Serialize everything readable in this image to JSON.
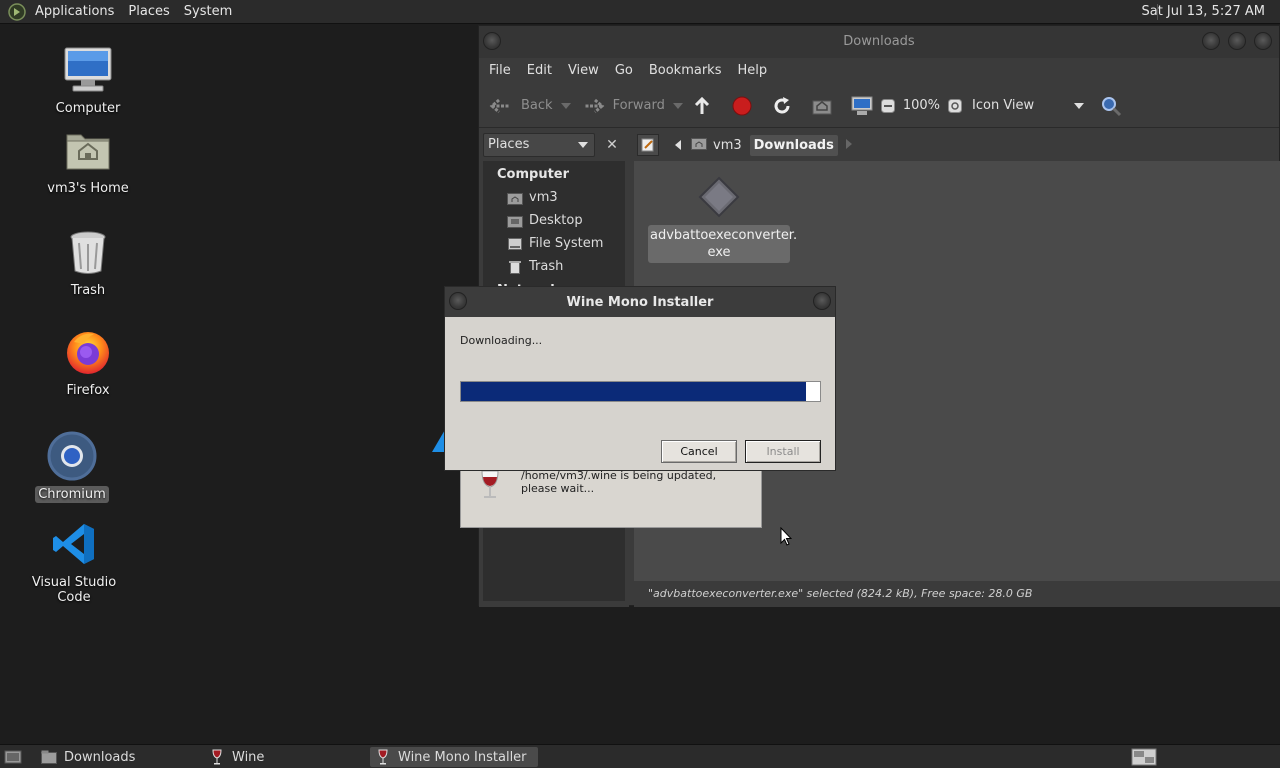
{
  "top_panel": {
    "menus": [
      "Applications",
      "Places",
      "System"
    ],
    "clock": "Sat Jul 13,  5:27 AM"
  },
  "desktop": {
    "icons": [
      {
        "label": "Computer",
        "icon": "computer-icon"
      },
      {
        "label": "vm3's Home",
        "icon": "home-folder-icon"
      },
      {
        "label": "Trash",
        "icon": "trash-icon"
      },
      {
        "label": "Firefox",
        "icon": "firefox-icon"
      },
      {
        "label": "Chromium",
        "icon": "chromium-icon",
        "selected": true
      },
      {
        "label": "Visual Studio Code",
        "icon": "vscode-icon"
      }
    ]
  },
  "file_manager": {
    "title": "Downloads",
    "menus": [
      "File",
      "Edit",
      "View",
      "Go",
      "Bookmarks",
      "Help"
    ],
    "toolbar": {
      "back": "Back",
      "forward": "Forward",
      "zoom": "100%",
      "view_mode": "Icon View"
    },
    "sidebar": {
      "selector": "Places",
      "section": "Computer",
      "items": [
        "vm3",
        "Desktop",
        "File System",
        "Trash"
      ],
      "partial_section": "Network"
    },
    "path": [
      "vm3",
      "Downloads"
    ],
    "files": [
      {
        "name_line1": "advbattoexeconverter.",
        "name_line2": "exe"
      }
    ],
    "status": "\"advbattoexeconverter.exe\" selected (824.2 kB), Free space: 28.0 GB"
  },
  "wine_dialog": {
    "message": "/home/vm3/.wine is being updated, please wait..."
  },
  "mono_installer": {
    "title": "Wine Mono Installer",
    "status": "Downloading...",
    "progress": 0.96,
    "cancel_label": "Cancel",
    "install_label": "Install"
  },
  "taskbar": {
    "tasks": [
      {
        "label": "Downloads",
        "icon": "folder-icon"
      },
      {
        "label": "Wine",
        "icon": "wine-glass-icon"
      },
      {
        "label": "Wine Mono Installer",
        "icon": "wine-glass-icon",
        "active": true
      }
    ]
  }
}
